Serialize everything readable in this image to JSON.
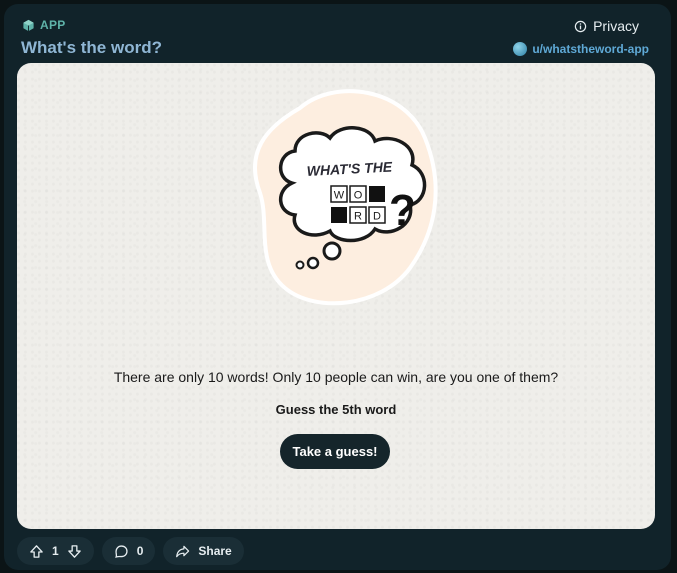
{
  "header": {
    "app_tag": "APP",
    "title": "What's the word?",
    "privacy_label": "Privacy",
    "author": "u/whatstheword-app"
  },
  "logo": {
    "line1": "WHAT'S THE",
    "tiles_row1": [
      "W",
      "O",
      ""
    ],
    "tiles_row2": [
      "",
      "R",
      "D"
    ],
    "question_mark": "?"
  },
  "main": {
    "prompt": "There are only 10 words! Only 10 people can win, are you one of them?",
    "guess_label": "Guess the 5th word",
    "guess_button": "Take a guess!"
  },
  "footer": {
    "vote_count": "1",
    "comment_count": "0",
    "share_label": "Share"
  },
  "colors": {
    "page_bg": "#0b1416",
    "card_bg": "#11232a",
    "title_color": "#8fb6d4",
    "panel_bg": "#efeeea",
    "button_bg": "#15252b",
    "blob_color": "#fdeee0"
  }
}
